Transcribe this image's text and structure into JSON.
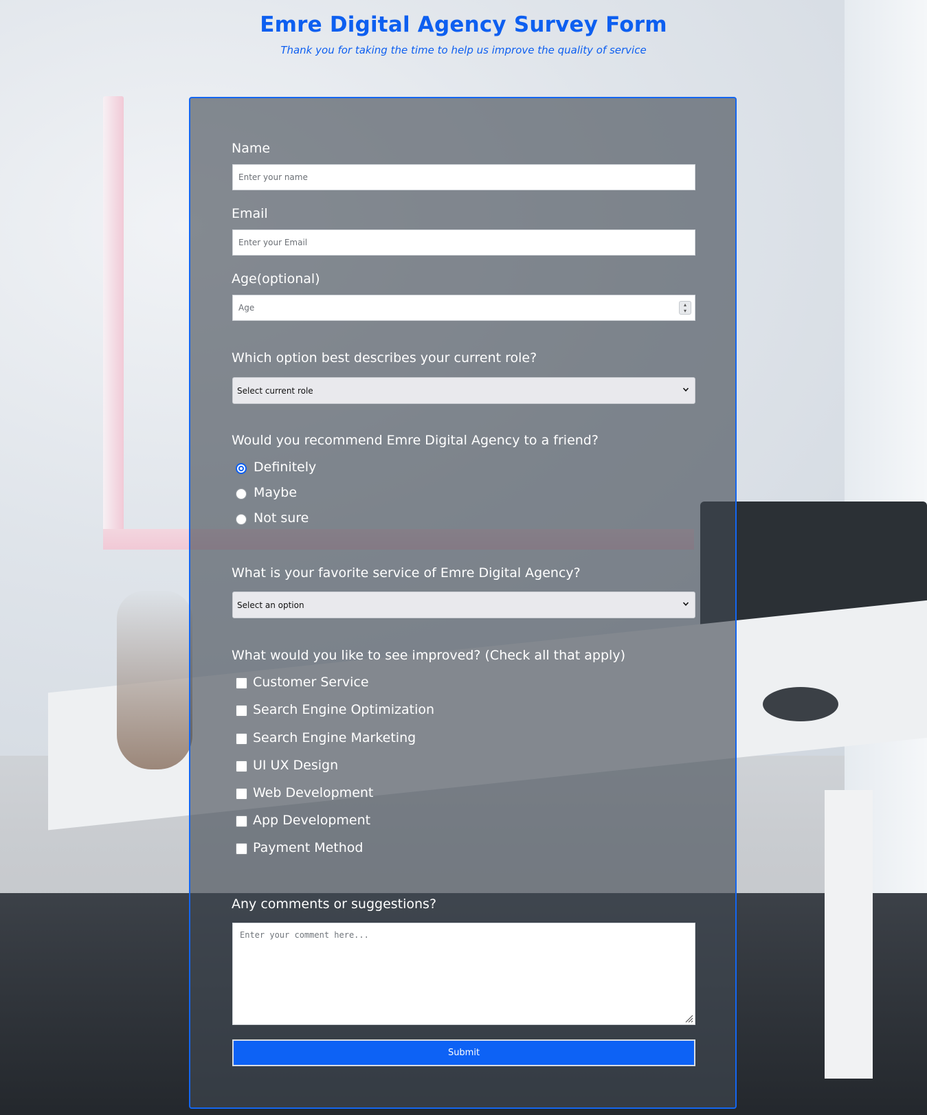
{
  "header": {
    "title": "Emre Digital Agency Survey Form",
    "subtitle": "Thank you for taking the time to help us improve the quality of service"
  },
  "form": {
    "name": {
      "label": "Name",
      "placeholder": "Enter your name",
      "value": ""
    },
    "email": {
      "label": "Email",
      "placeholder": "Enter your Email",
      "value": ""
    },
    "age": {
      "label": "Age(optional)",
      "placeholder": "Age",
      "value": ""
    },
    "role": {
      "label": "Which option best describes your current role?",
      "selected": "Select current role"
    },
    "recommend": {
      "label": "Would you recommend Emre Digital Agency to a friend?",
      "options": [
        "Definitely",
        "Maybe",
        "Not sure"
      ],
      "selected_index": 0
    },
    "favorite_service": {
      "label": "What is your favorite service of Emre Digital Agency?",
      "selected": "Select an option"
    },
    "improvements": {
      "label": "What would you like to see improved? (Check all that apply)",
      "options": [
        "Customer Service",
        "Search Engine Optimization",
        "Search Engine Marketing",
        "UI UX Design",
        "Web Development",
        "App Development",
        "Payment Method"
      ]
    },
    "comments": {
      "label": "Any comments or suggestions?",
      "placeholder": "Enter your comment here..."
    },
    "submit_label": "Submit"
  },
  "colors": {
    "accent": "#0d5ff0",
    "panel_border": "#1466f0",
    "submit_bg": "#0d62f5"
  },
  "icons": {
    "select_chevron": "chevron-down-icon",
    "stepper": "number-stepper-icon",
    "resize": "resize-grip-icon"
  }
}
